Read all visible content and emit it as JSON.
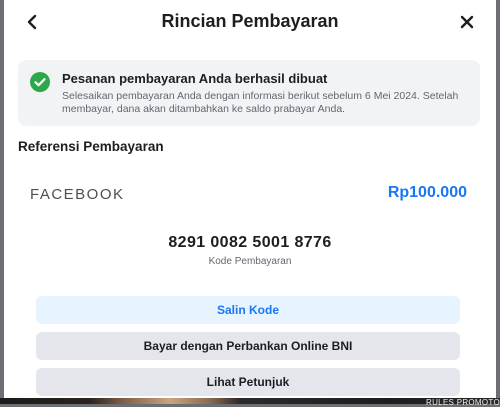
{
  "header": {
    "title": "Rincian Pembayaran",
    "back_icon": "chevron-left-icon",
    "close_icon": "close-icon"
  },
  "notice": {
    "icon": "check-circle-icon",
    "title": "Pesanan pembayaran Anda berhasil dibuat",
    "body": "Selesaikan pembayaran Anda dengan informasi berikut sebelum 6 Mei 2024. Setelah membayar, dana akan ditambahkan ke saldo prabayar Anda."
  },
  "reference": {
    "section_title": "Referensi Pembayaran",
    "merchant": "FACEBOOK",
    "amount": "Rp100.000",
    "code": "8291 0082 5001 8776",
    "code_label": "Kode Pembayaran"
  },
  "actions": {
    "copy_label": "Salin Kode",
    "bank_label": "Bayar dengan Perbankan Online BNI",
    "guide_label": "Lihat Petunjuk"
  },
  "background": {
    "strip_text": "RULES PROMOTO"
  },
  "colors": {
    "accent": "#1877f2",
    "success": "#2aa84a",
    "notice_bg": "#f2f3f5",
    "button_bg": "#e4e6eb",
    "primary_light_bg": "#e7f3ff"
  }
}
